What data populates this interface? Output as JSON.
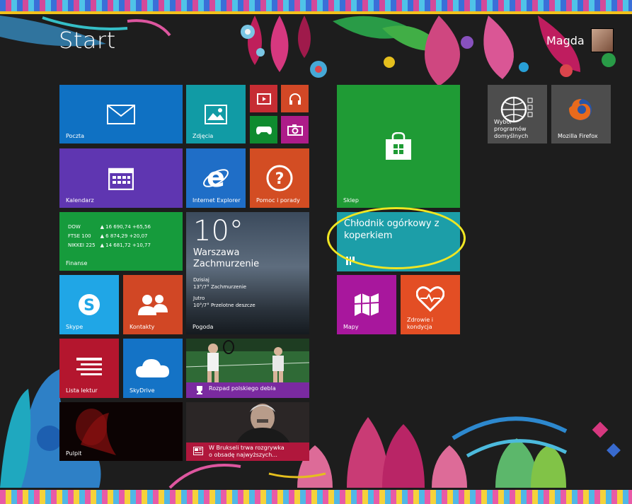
{
  "header": {
    "title": "Start",
    "user_name": "Magda"
  },
  "tiles": {
    "mail": "Poczta",
    "photos": "Zdjęcia",
    "calendar": "Kalendarz",
    "ie": "Internet Explorer",
    "help": "Pomoc i porady",
    "finance": {
      "label": "Finanse",
      "rows": [
        [
          "DOW",
          "▲ 16 690,74 +65,56"
        ],
        [
          "FTSE 100",
          "▲ 6 874,29 +20,07"
        ],
        [
          "NIKKEI 225",
          "▲ 14 681,72 +10,77"
        ]
      ]
    },
    "weather": {
      "temp": "10°",
      "city": "Warszawa",
      "condition": "Zachmurzenie",
      "today_label": "Dzisiaj",
      "today_value": "13°/7° Zachmurzenie",
      "tomorrow_label": "Jutro",
      "tomorrow_value": "10°/7° Przelotne deszcze",
      "label": "Pogoda"
    },
    "skype": "Skype",
    "contacts": "Kontakty",
    "reading": "Lista lektur",
    "skydrive": "SkyDrive",
    "sport": "Rozpad polskiego debla",
    "desktop": "Pulpit",
    "news": "W Brukseli trwa rozgrywka o obsadę najwyższych...",
    "store": "Sklep",
    "recipe": "Chłodnik ogórkowy z koperkiem",
    "maps": "Mapy",
    "health": "Zdrowie i kondycja",
    "defaults": "Wybór programów domyślnych",
    "firefox": "Mozilla Firefox"
  },
  "colors": {
    "highlight": "#f0e623",
    "background": "#1d1d1d"
  }
}
